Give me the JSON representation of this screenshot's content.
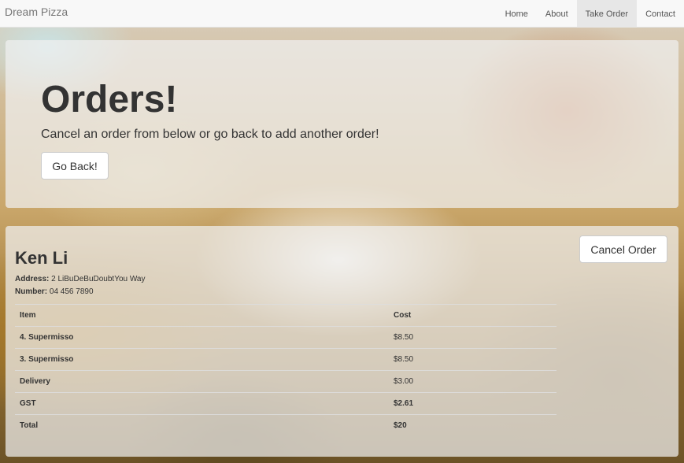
{
  "navbar": {
    "brand": "Dream Pizza",
    "items": [
      {
        "label": "Home",
        "active": false
      },
      {
        "label": "About",
        "active": false
      },
      {
        "label": "Take Order",
        "active": true
      },
      {
        "label": "Contact",
        "active": false
      }
    ]
  },
  "jumbotron": {
    "title": "Orders!",
    "subtitle": "Cancel an order from below or go back to add another order!",
    "back_button": "Go Back!"
  },
  "order": {
    "cancel_button": "Cancel Order",
    "customer_name": "Ken Li",
    "address_label": "Address:",
    "address_value": "2 LiBuDeBuDoubtYou Way",
    "number_label": "Number:",
    "number_value": "04 456 7890",
    "table": {
      "headers": [
        "Item",
        "Cost"
      ],
      "rows": [
        {
          "item": "4. Supermisso",
          "cost": "$8.50"
        },
        {
          "item": "3. Supermisso",
          "cost": "$8.50"
        },
        {
          "item": "Delivery",
          "cost": "$3.00"
        },
        {
          "item": "GST",
          "cost": "$2.61"
        },
        {
          "item": "Total",
          "cost": "$20"
        }
      ]
    }
  },
  "colors": {
    "navbar_bg": "#f8f8f8",
    "active_nav_bg": "#e7e7e7",
    "text": "#333333"
  }
}
